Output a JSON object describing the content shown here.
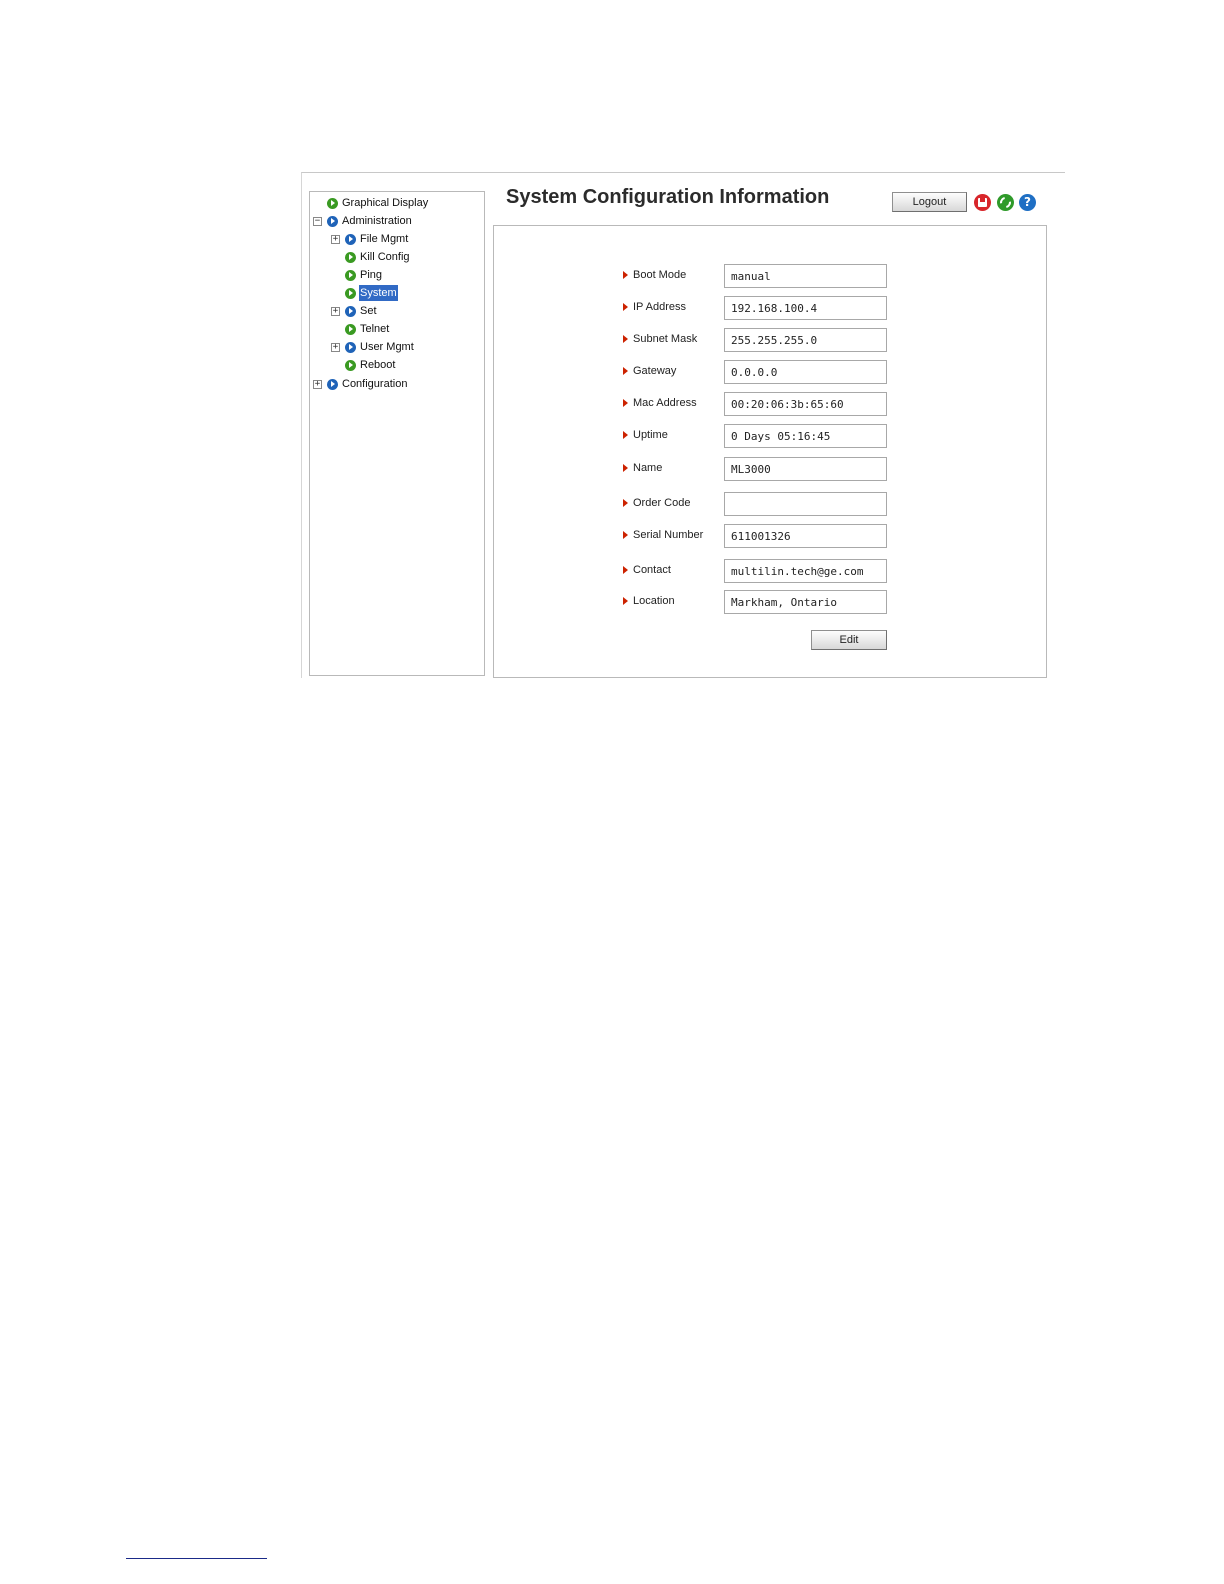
{
  "page_title": "System Configuration Information",
  "toolbar": {
    "logout_label": "Logout",
    "icons": [
      "save-icon",
      "refresh-icon",
      "help-icon"
    ],
    "help_glyph": "?"
  },
  "nav_tree": {
    "items": [
      {
        "label": "Graphical Display",
        "level": 0,
        "expander": "",
        "icon_color": "green",
        "selected": false
      },
      {
        "label": "Administration",
        "level": 0,
        "expander": "−",
        "icon_color": "blue",
        "selected": false
      },
      {
        "label": "File Mgmt",
        "level": 1,
        "expander": "+",
        "icon_color": "blue",
        "selected": false
      },
      {
        "label": "Kill Config",
        "level": 1,
        "expander": "",
        "icon_color": "green",
        "selected": false
      },
      {
        "label": "Ping",
        "level": 1,
        "expander": "",
        "icon_color": "green",
        "selected": false
      },
      {
        "label": "System",
        "level": 1,
        "expander": "",
        "icon_color": "green",
        "selected": true
      },
      {
        "label": "Set",
        "level": 1,
        "expander": "+",
        "icon_color": "blue",
        "selected": false
      },
      {
        "label": "Telnet",
        "level": 1,
        "expander": "",
        "icon_color": "green",
        "selected": false
      },
      {
        "label": "User Mgmt",
        "level": 1,
        "expander": "+",
        "icon_color": "blue",
        "selected": false
      },
      {
        "label": "Reboot",
        "level": 1,
        "expander": "",
        "icon_color": "green",
        "selected": false
      },
      {
        "label": "Configuration",
        "level": 0,
        "expander": "+",
        "icon_color": "blue",
        "selected": false
      }
    ]
  },
  "fields": [
    {
      "label": "Boot Mode",
      "value": "manual"
    },
    {
      "label": "IP Address",
      "value": "192.168.100.4"
    },
    {
      "label": "Subnet Mask",
      "value": "255.255.255.0"
    },
    {
      "label": "Gateway",
      "value": "0.0.0.0"
    },
    {
      "label": "Mac Address",
      "value": "00:20:06:3b:65:60"
    },
    {
      "label": "Uptime",
      "value": "0 Days 05:16:45"
    },
    {
      "label": "Name",
      "value": "ML3000"
    },
    {
      "label": "Order Code",
      "value": ""
    },
    {
      "label": "Serial Number",
      "value": "611001326"
    },
    {
      "label": "Contact",
      "value": "multilin.tech@ge.com"
    },
    {
      "label": "Location",
      "value": "Markham, Ontario"
    }
  ],
  "edit_label": "Edit",
  "colors": {
    "selected_bg": "#316ac5",
    "bullet_red": "#cc2200",
    "nav_green": "#3a9a22",
    "nav_blue": "#1f63b8"
  }
}
